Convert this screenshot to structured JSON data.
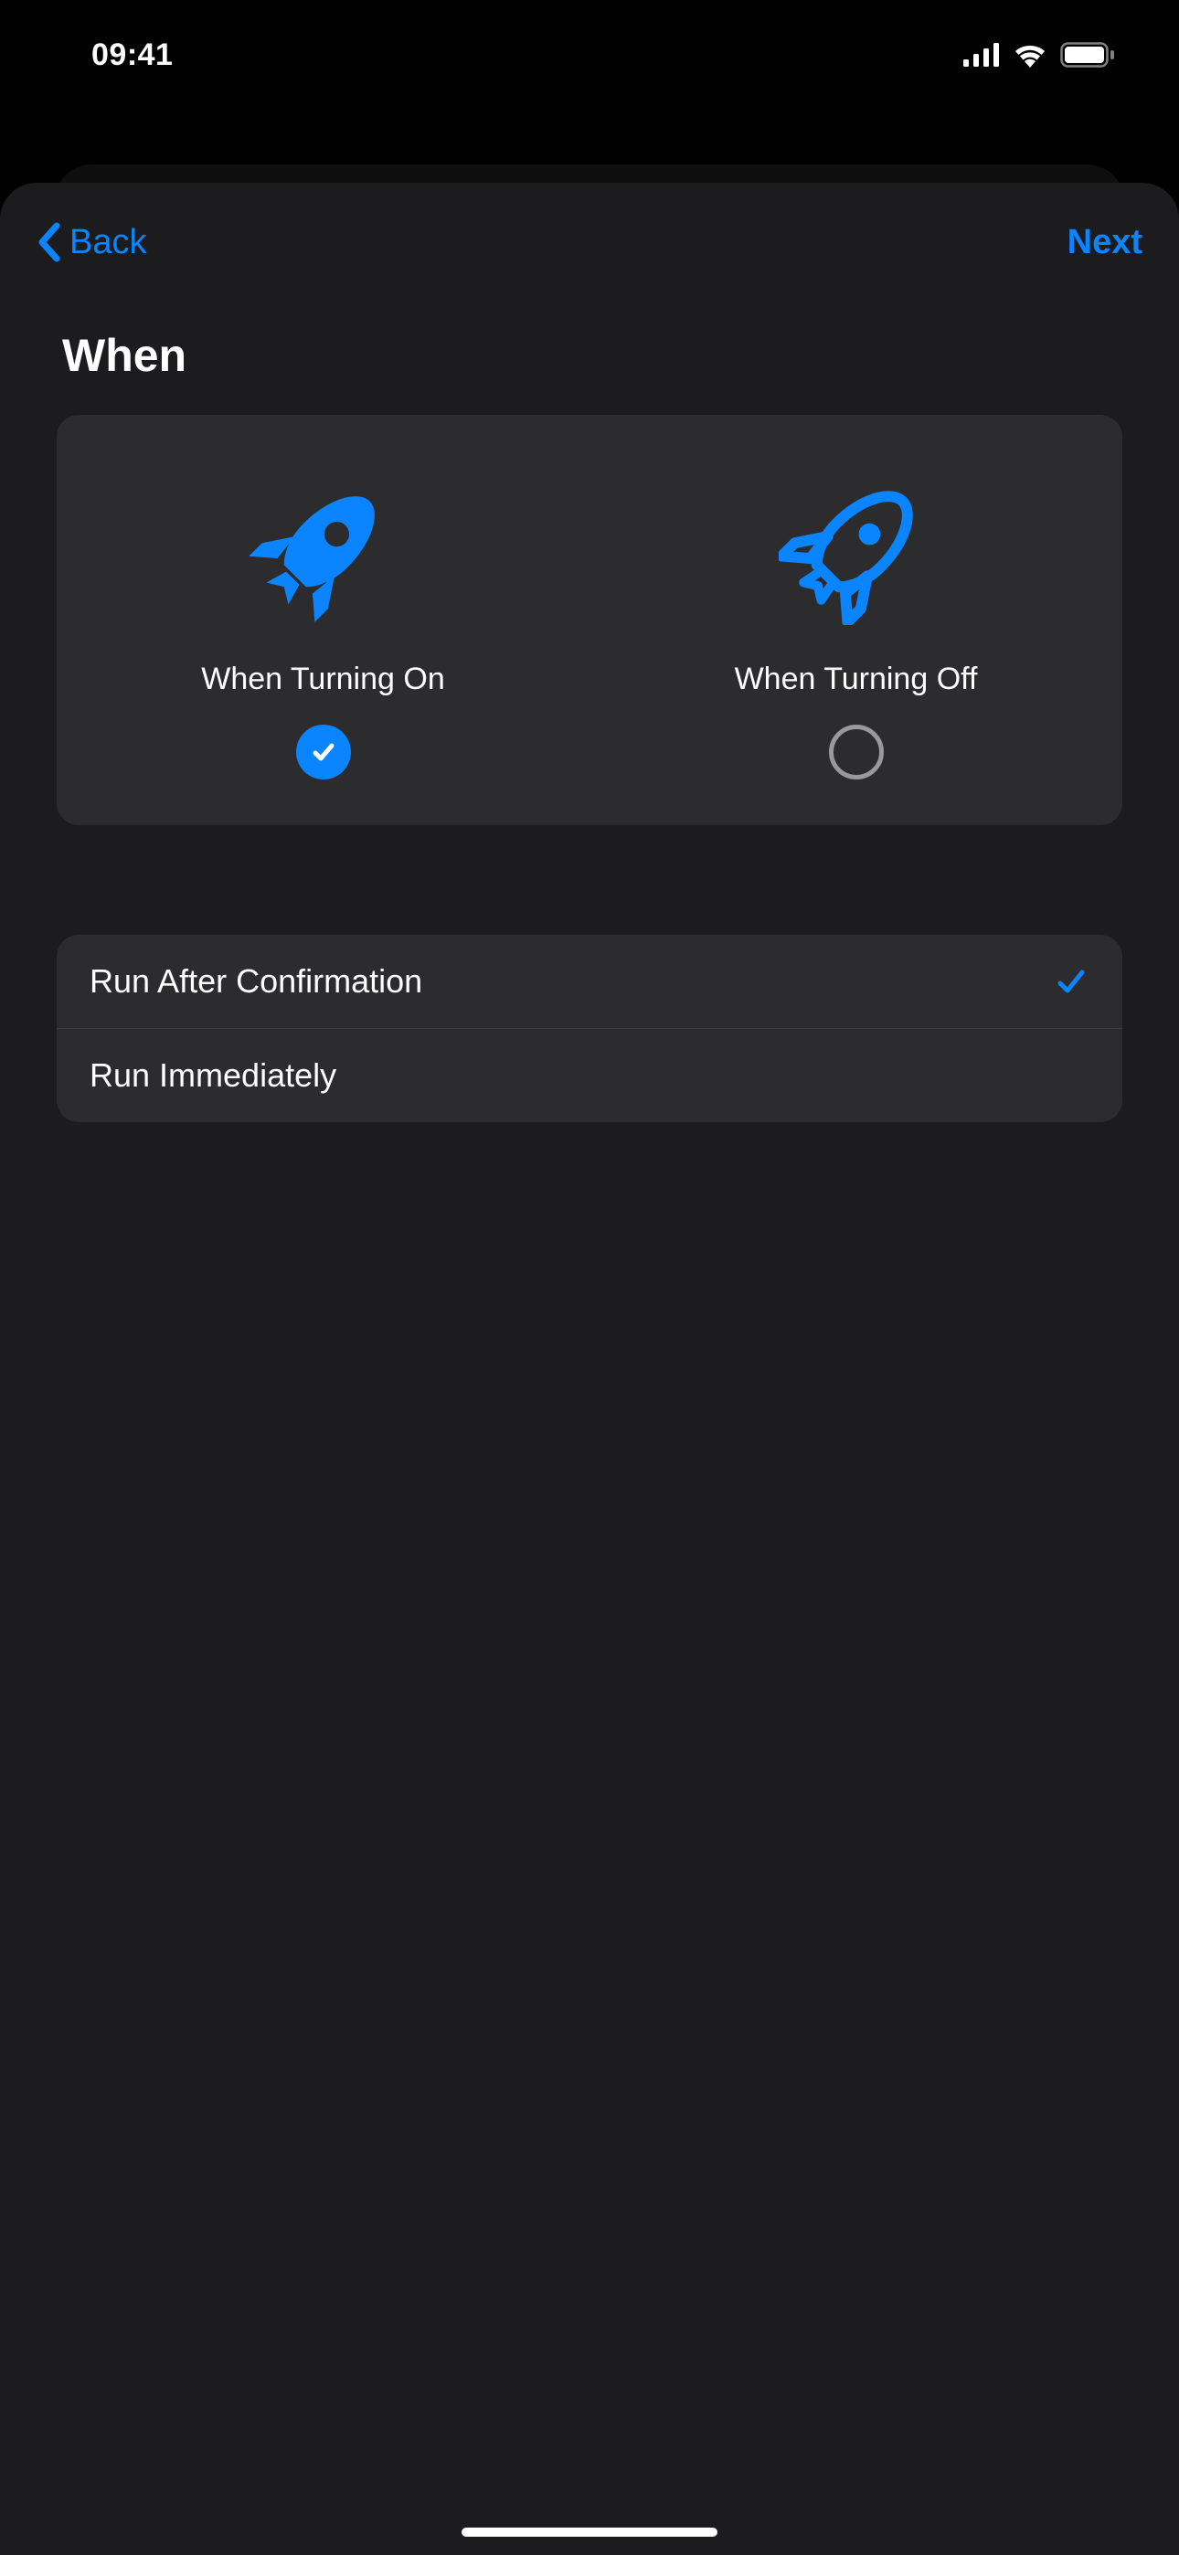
{
  "status": {
    "time": "09:41"
  },
  "nav": {
    "back": "Back",
    "next": "Next"
  },
  "section": {
    "title": "When"
  },
  "when_options": [
    {
      "label": "When Turning On",
      "selected": true
    },
    {
      "label": "When Turning Off",
      "selected": false
    }
  ],
  "run_options": [
    {
      "label": "Run After Confirmation",
      "selected": true
    },
    {
      "label": "Run Immediately",
      "selected": false
    }
  ]
}
